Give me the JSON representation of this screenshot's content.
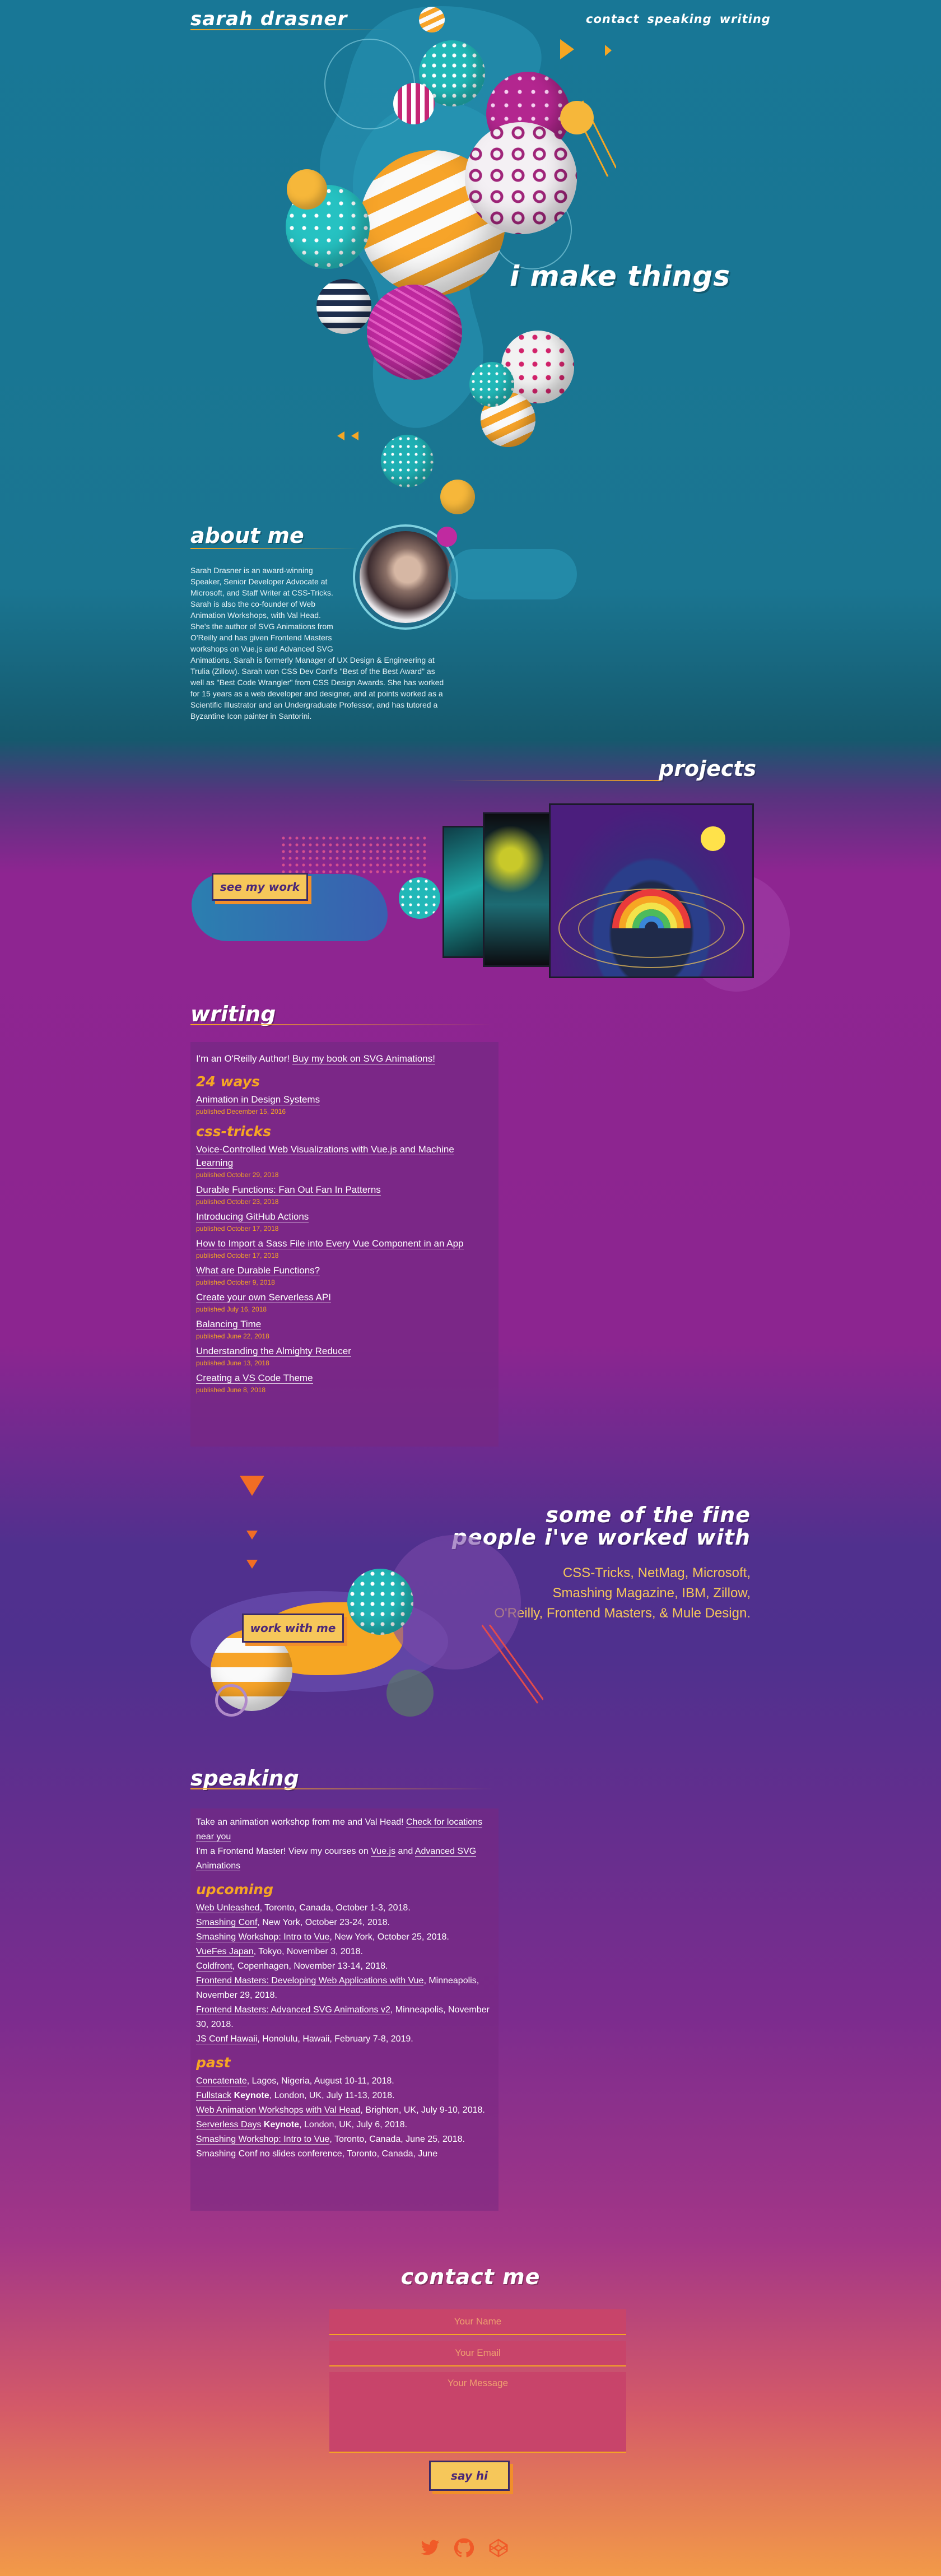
{
  "site": {
    "logo": "sarah drasner",
    "nav": [
      {
        "label": "contact"
      },
      {
        "label": "speaking"
      },
      {
        "label": "writing"
      }
    ],
    "hero_tagline": "i make things"
  },
  "about": {
    "title": "about me",
    "bio_lines": [
      "Sarah Drasner is an award-winning",
      "Speaker, Senior Developer Advocate at",
      "Microsoft, and Staff Writer at CSS-Tricks.",
      "Sarah is also the co-founder of Web",
      "Animation Workshops, with Val Head.",
      "She's the author of SVG Animations from",
      "O'Reilly and has given Frontend Masters",
      "workshops on Vue.js and Advanced SVG",
      "Animations. Sarah is formerly Manager of UX Design & Engineering at",
      "Trulia (Zillow). Sarah won CSS Dev Conf's \"Best of the Best Award\" as",
      "well as \"Best Code Wrangler\" from CSS Design Awards. She has worked",
      "for 15 years as a web developer and designer, and at points worked as a",
      "Scientific Illustrator and an Undergraduate Professor, and has tutored a",
      "Byzantine Icon painter in Santorini."
    ]
  },
  "projects": {
    "title": "projects",
    "button": "see my work"
  },
  "writing": {
    "title": "writing",
    "intro_text": "I'm an O'Reilly Author! ",
    "intro_link": "Buy my book on SVG Animations!",
    "groups": [
      {
        "name": "24 ways",
        "posts": [
          {
            "title": "Animation in Design Systems",
            "date": "published December 15, 2016"
          }
        ]
      },
      {
        "name": "css-tricks",
        "posts": [
          {
            "title": "Voice-Controlled Web Visualizations with Vue.js and Machine Learning",
            "date": "published October 29, 2018"
          },
          {
            "title": "Durable Functions: Fan Out Fan In Patterns",
            "date": "published October 23, 2018"
          },
          {
            "title": "Introducing GitHub Actions",
            "date": "published October 17, 2018"
          },
          {
            "title": "How to Import a Sass File into Every Vue Component in an App",
            "date": "published October 17, 2018"
          },
          {
            "title": "What are Durable Functions?",
            "date": "published October 9, 2018"
          },
          {
            "title": "Create your own Serverless API",
            "date": "published July 16, 2018"
          },
          {
            "title": "Balancing Time",
            "date": "published June 22, 2018"
          },
          {
            "title": "Understanding the Almighty Reducer",
            "date": "published June 13, 2018"
          },
          {
            "title": "Creating a VS Code Theme",
            "date": "published June 8, 2018"
          }
        ]
      }
    ]
  },
  "clients": {
    "title_line1": "some of the fine",
    "title_line2": "people i've worked with",
    "lines": [
      "CSS-Tricks, NetMag, Microsoft,",
      "Smashing Magazine, IBM, Zillow,",
      "O'Reilly, Frontend Masters, & Mule Design."
    ],
    "button": "work with me"
  },
  "speaking": {
    "title": "speaking",
    "intro1_text": "Take an animation workshop from me and Val Head! ",
    "intro1_link": "Check for locations near you",
    "intro2_text": "I'm a Frontend Master! View my courses on ",
    "intro2_link1": "Vue.js",
    "intro2_mid": " and ",
    "intro2_link2": "Advanced SVG Animations",
    "upcoming_title": "upcoming",
    "upcoming": [
      {
        "link": "Web Unleashed",
        "rest": ", Toronto, Canada, October 1-3, 2018."
      },
      {
        "link": "Smashing Conf",
        "rest": ", New York, October 23-24, 2018."
      },
      {
        "link": "Smashing Workshop: Intro to Vue",
        "rest": ", New York, October 25, 2018."
      },
      {
        "link": "VueFes Japan",
        "rest": ", Tokyo, November 3, 2018."
      },
      {
        "link": "Coldfront",
        "rest": ", Copenhagen, November 13-14, 2018."
      },
      {
        "link": "Frontend Masters: Developing Web Applications with Vue",
        "rest": ", Minneapolis, November 29, 2018."
      },
      {
        "link": "Frontend Masters: Advanced SVG Animations v2",
        "rest": ", Minneapolis, November 30, 2018."
      },
      {
        "link": "JS Conf Hawaii",
        "rest": ", Honolulu, Hawaii, February 7-8, 2019."
      }
    ],
    "past_title": "past",
    "past": [
      {
        "link": "Concatenate",
        "keynote": "",
        "rest": ", Lagos, Nigeria, August 10-11, 2018."
      },
      {
        "link": "Fullstack",
        "keynote": " Keynote",
        "rest": ", London, UK, July 11-13, 2018."
      },
      {
        "link": "Web Animation Workshops with Val Head",
        "keynote": "",
        "rest": ", Brighton, UK, July 9-10, 2018."
      },
      {
        "link": "Serverless Days",
        "keynote": " Keynote",
        "rest": ", London, UK, July 6, 2018."
      },
      {
        "link": "Smashing Workshop: Intro to Vue",
        "keynote": "",
        "rest": ", Toronto, Canada, June 25, 2018."
      },
      {
        "link": "",
        "keynote": "",
        "rest": "Smashing Conf no slides conference, Toronto, Canada, June"
      }
    ]
  },
  "contact": {
    "title": "contact me",
    "name_placeholder": "Your Name",
    "email_placeholder": "Your Email",
    "message_placeholder": "Your Message",
    "submit": "say hi"
  },
  "footer": {
    "icons": [
      "twitter-icon",
      "github-icon",
      "codepen-icon"
    ]
  },
  "colors": {
    "accent": "#f6a623",
    "teal_bg": "#187796",
    "purple_bg": "#8e2591",
    "button_fill": "#f6c75a"
  }
}
